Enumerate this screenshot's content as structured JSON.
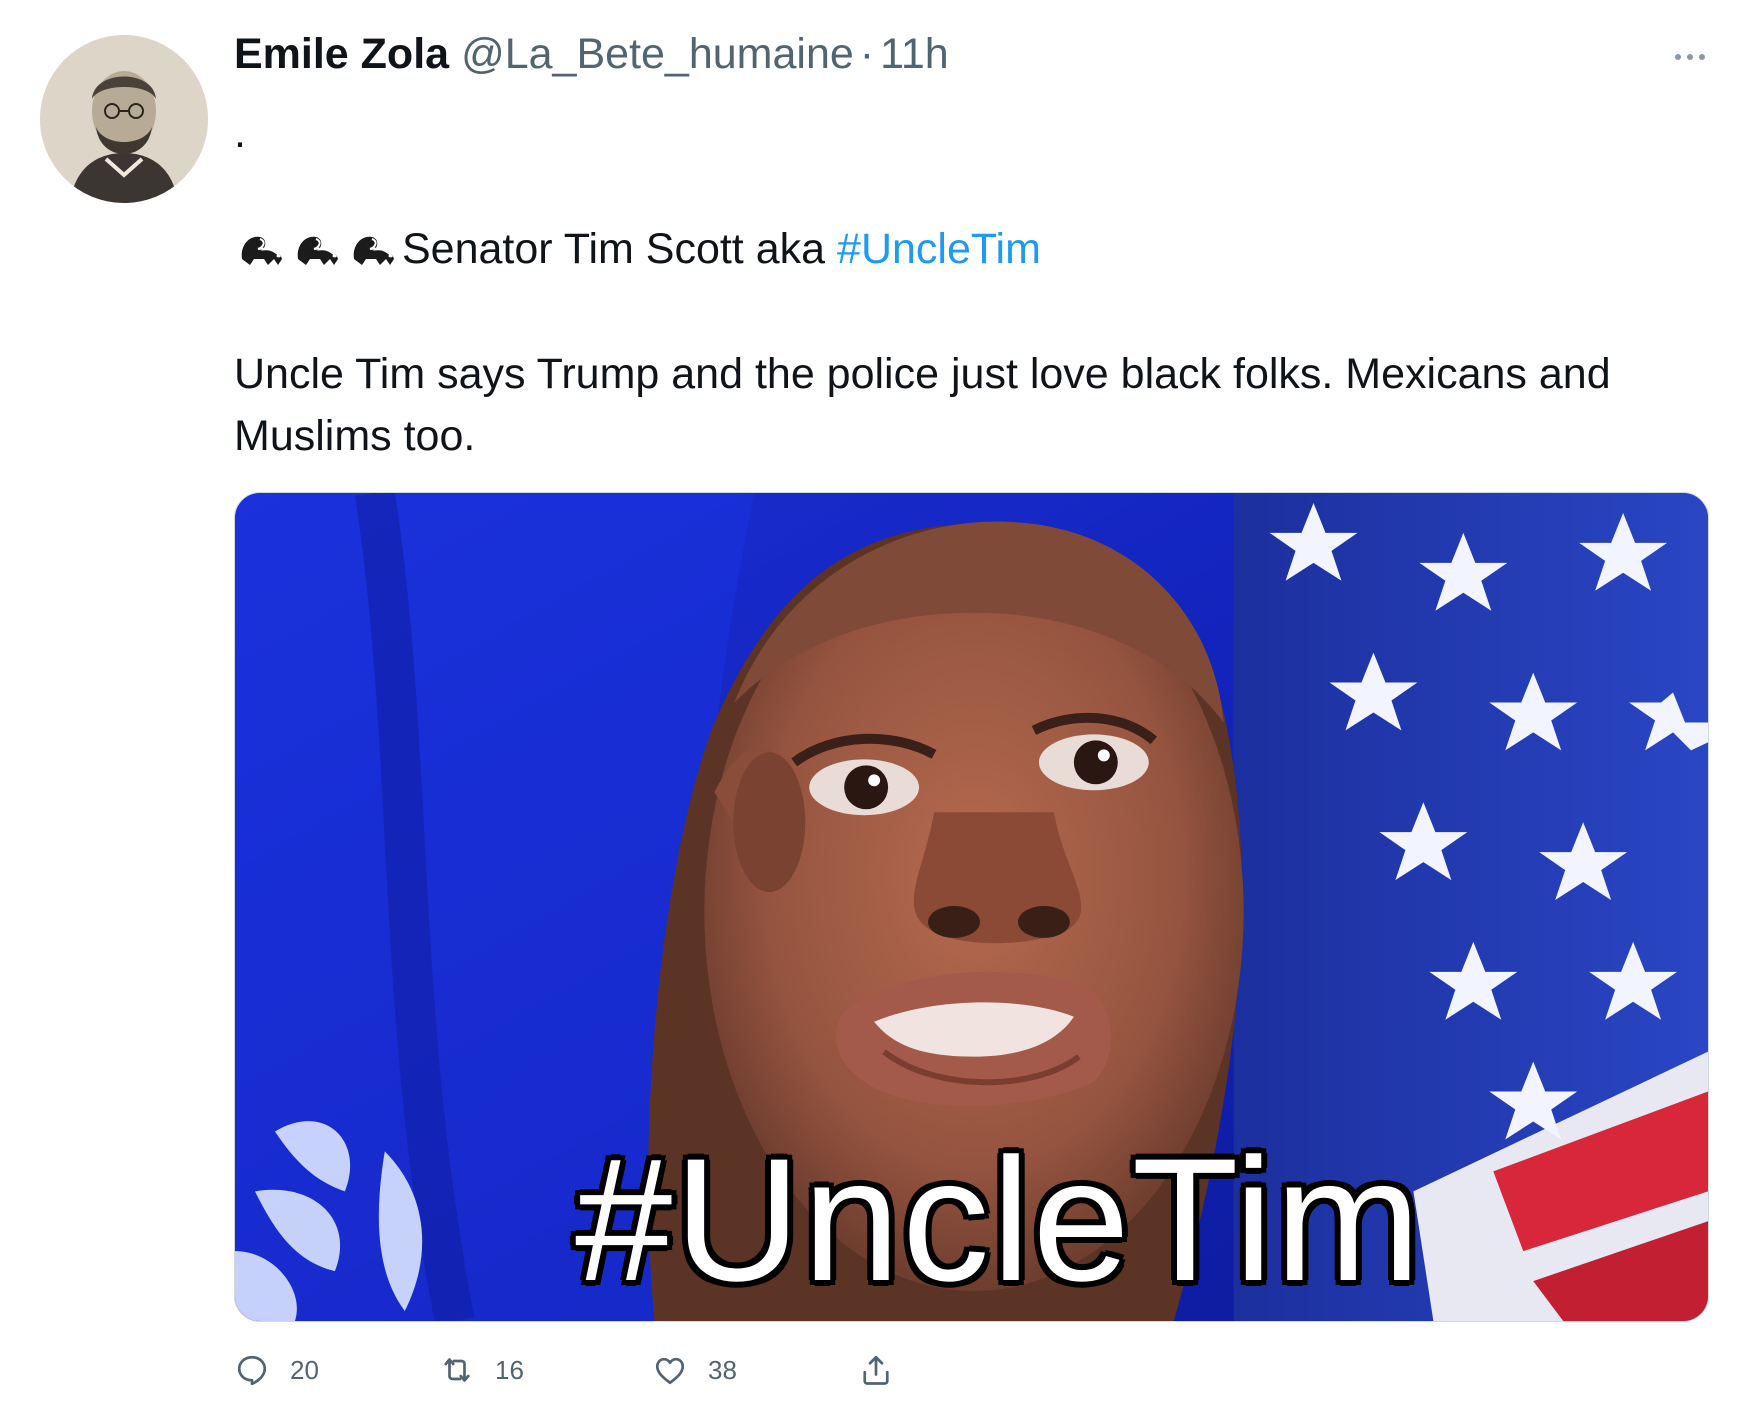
{
  "tweet": {
    "author": {
      "name": "Emile Zola",
      "handle": "@La_Bete_humaine",
      "separator": "·",
      "time": "11h",
      "avatar_icon": "engraved-portrait-avatar"
    },
    "more_icon": "more-horizontal-icon",
    "body": {
      "line_dot": ".",
      "emoji_icon": "skunk-emoji",
      "emoji_count": 3,
      "line_1_text": "Senator Tim Scott aka",
      "hashtag": "#UncleTim",
      "line_2_text": "Uncle Tim says Trump and the police just love black folks. Mexicans and Muslims too."
    },
    "media": {
      "caption": "#UncleTim"
    },
    "actions": {
      "reply_count": "20",
      "retweet_count": "16",
      "like_count": "38",
      "icons": [
        "reply-icon",
        "retweet-icon",
        "like-icon",
        "share-icon"
      ]
    },
    "colors": {
      "link": "#1d9bf0",
      "secondary_text": "#536471",
      "primary_text": "#0f1419"
    }
  }
}
